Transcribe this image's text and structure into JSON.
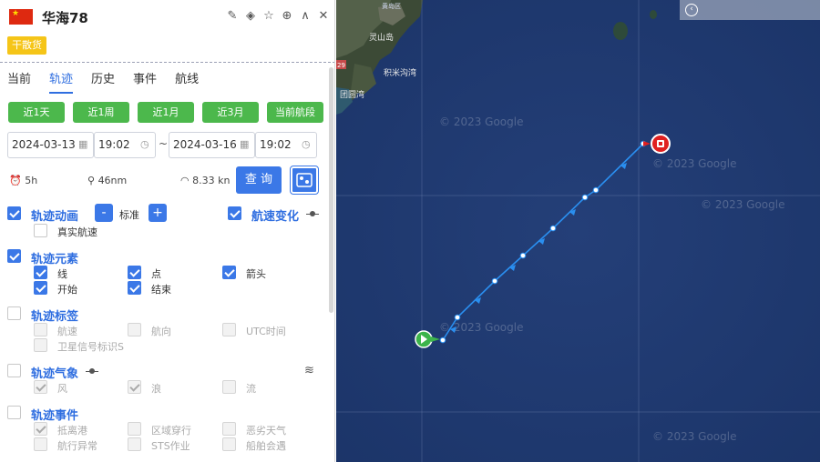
{
  "ship": {
    "name": "华海78",
    "type_badge": "干散货",
    "flag_color": "#de2910"
  },
  "header_icons": [
    "edit-icon",
    "tag-icon",
    "star-icon",
    "target-icon",
    "collapse-icon",
    "close-icon"
  ],
  "tabs": [
    {
      "label": "当前",
      "active": false
    },
    {
      "label": "轨迹",
      "active": true
    },
    {
      "label": "历史",
      "active": false
    },
    {
      "label": "事件",
      "active": false
    },
    {
      "label": "航线",
      "active": false
    }
  ],
  "range_buttons": [
    "近1天",
    "近1周",
    "近1月",
    "近3月",
    "当前航段"
  ],
  "date_range": {
    "start_date": "2024-03-13",
    "start_time": "19:02",
    "separator": "~",
    "end_date": "2024-03-16",
    "end_time": "19:02"
  },
  "stats": {
    "duration": "5h",
    "distance": "46nm",
    "speed": "8.33 kn"
  },
  "query_label": "查 询",
  "animation": {
    "title": "轨迹动画",
    "checked": true,
    "minus": "-",
    "level": "标准",
    "plus": "+",
    "real_speed_label": "真实航速",
    "real_speed_checked": false,
    "speed_change_label": "航速变化",
    "speed_change_checked": true
  },
  "elements": {
    "title": "轨迹元素",
    "checked": true,
    "items": [
      {
        "label": "线",
        "checked": true
      },
      {
        "label": "点",
        "checked": true
      },
      {
        "label": "箭头",
        "checked": true
      },
      {
        "label": "开始",
        "checked": true
      },
      {
        "label": "结束",
        "checked": true
      }
    ]
  },
  "labels": {
    "title": "轨迹标签",
    "checked": false,
    "items": [
      {
        "label": "航速",
        "checked": false
      },
      {
        "label": "航向",
        "checked": false
      },
      {
        "label": "UTC时间",
        "checked": false
      },
      {
        "label": "卫星信号标识S",
        "checked": false
      }
    ]
  },
  "weather": {
    "title": "轨迹气象",
    "checked": false,
    "items": [
      {
        "label": "风",
        "checked": true
      },
      {
        "label": "浪",
        "checked": true
      },
      {
        "label": "流",
        "checked": false
      }
    ]
  },
  "events": {
    "title": "轨迹事件",
    "checked": false,
    "items": [
      {
        "label": "抵离港",
        "checked": true
      },
      {
        "label": "区域穿行",
        "checked": false
      },
      {
        "label": "恶劣天气",
        "checked": false
      },
      {
        "label": "航行异常",
        "checked": false
      },
      {
        "label": "STS作业",
        "checked": false
      },
      {
        "label": "船舶会遇",
        "checked": false
      }
    ]
  },
  "map": {
    "watermark": "© 2023 Google",
    "places": [
      "黄岛区",
      "灵山岛",
      "积米沟湾",
      "团圆湾"
    ],
    "track_color": "#2a8ff0",
    "start_color": "#3cb44b",
    "end_color": "#e02020"
  }
}
